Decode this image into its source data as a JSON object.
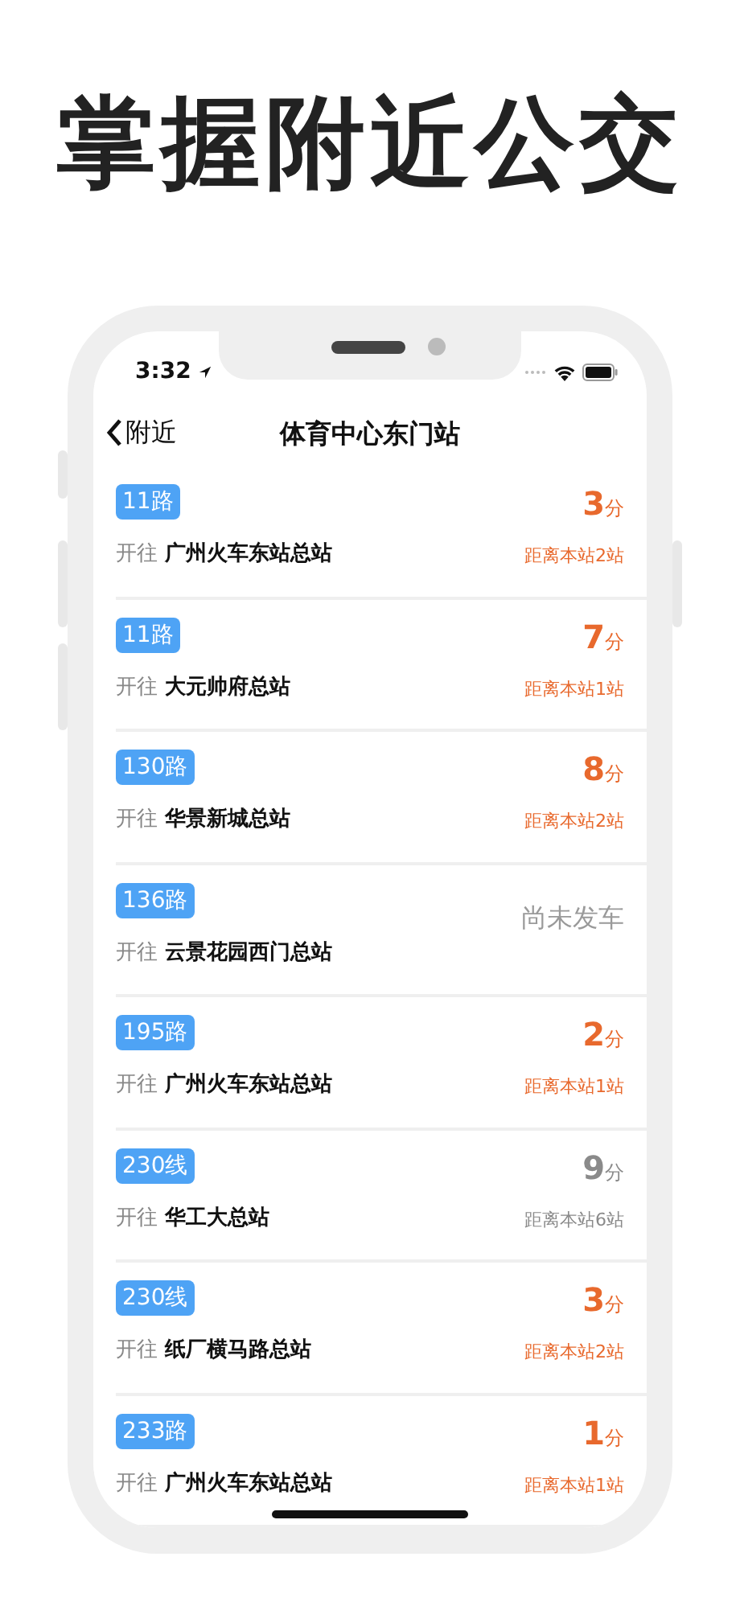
{
  "headline": "掌握附近公交",
  "status_bar": {
    "time": "3:32"
  },
  "nav_bar": {
    "back_label": "附近",
    "title": "体育中心东门站"
  },
  "routes": [
    {
      "route": "11路",
      "direction_label": "开往",
      "destination": "广州火车东站总站",
      "kind": "eta",
      "minutes": "3",
      "unit": "分",
      "distance": "距离本站2站",
      "color": "#e8692d"
    },
    {
      "route": "11路",
      "direction_label": "开往",
      "destination": "大元帅府总站",
      "kind": "eta",
      "minutes": "7",
      "unit": "分",
      "distance": "距离本站1站",
      "color": "#e8692d"
    },
    {
      "route": "130路",
      "direction_label": "开往",
      "destination": "华景新城总站",
      "kind": "eta",
      "minutes": "8",
      "unit": "分",
      "distance": "距离本站2站",
      "color": "#e8692d"
    },
    {
      "route": "136路",
      "direction_label": "开往",
      "destination": "云景花园西门总站",
      "kind": "status",
      "status": "尚未发车"
    },
    {
      "route": "195路",
      "direction_label": "开往",
      "destination": "广州火车东站总站",
      "kind": "eta",
      "minutes": "2",
      "unit": "分",
      "distance": "距离本站1站",
      "color": "#e8692d"
    },
    {
      "route": "230线",
      "direction_label": "开往",
      "destination": "华工大总站",
      "kind": "eta",
      "minutes": "9",
      "unit": "分",
      "distance": "距离本站6站",
      "color": "#8a8a8a"
    },
    {
      "route": "230线",
      "direction_label": "开往",
      "destination": "纸厂横马路总站",
      "kind": "eta",
      "minutes": "3",
      "unit": "分",
      "distance": "距离本站2站",
      "color": "#e8692d"
    },
    {
      "route": "233路",
      "direction_label": "开往",
      "destination": "广州火车东站总站",
      "kind": "eta",
      "minutes": "1",
      "unit": "分",
      "distance": "距离本站1站",
      "color": "#e8692d"
    }
  ]
}
